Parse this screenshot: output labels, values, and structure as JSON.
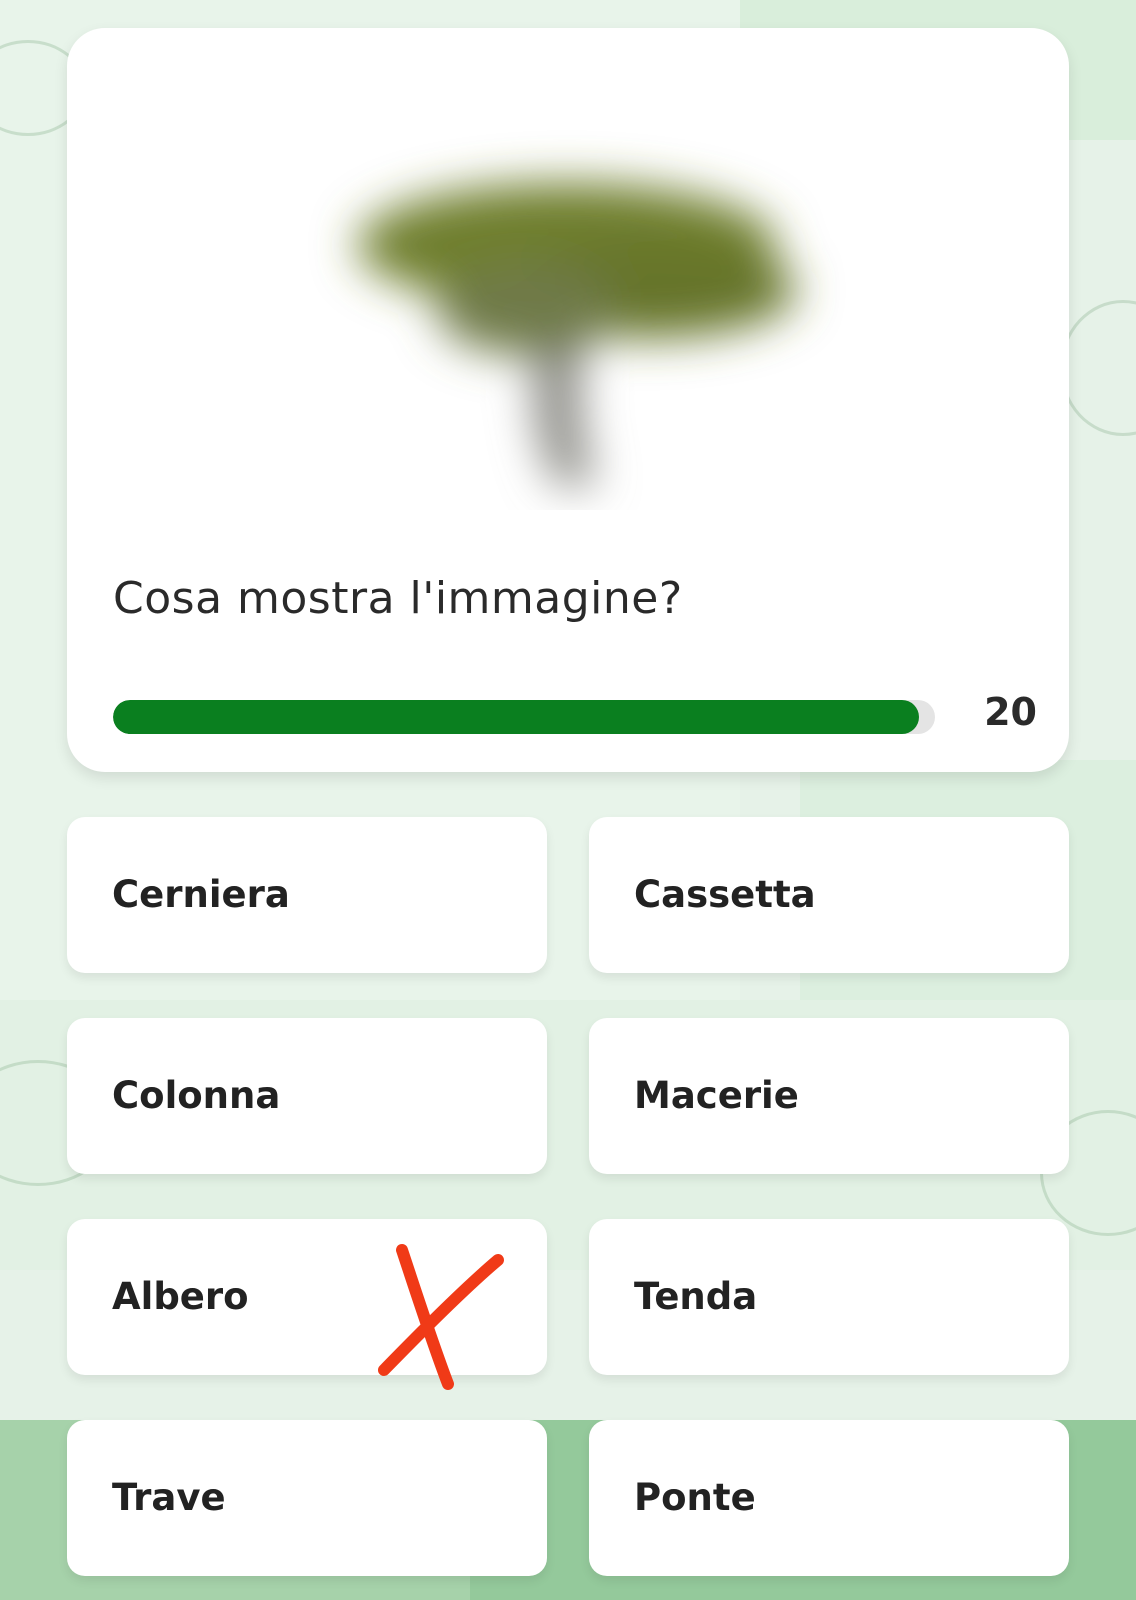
{
  "quiz": {
    "question": "Cosa mostra l'immagine?",
    "timer": "20",
    "progress_fraction": 0.98,
    "image_subject": "blurred-tree-image",
    "answers": [
      {
        "label": "Cerniera"
      },
      {
        "label": "Cassetta"
      },
      {
        "label": "Colonna"
      },
      {
        "label": "Macerie"
      },
      {
        "label": "Albero",
        "marked": "red-x"
      },
      {
        "label": "Tenda"
      },
      {
        "label": "Trave"
      },
      {
        "label": "Ponte"
      }
    ]
  },
  "colors": {
    "progress": "#0a7f1f",
    "mark": "#f03a17",
    "background": "#e6f2e8"
  }
}
